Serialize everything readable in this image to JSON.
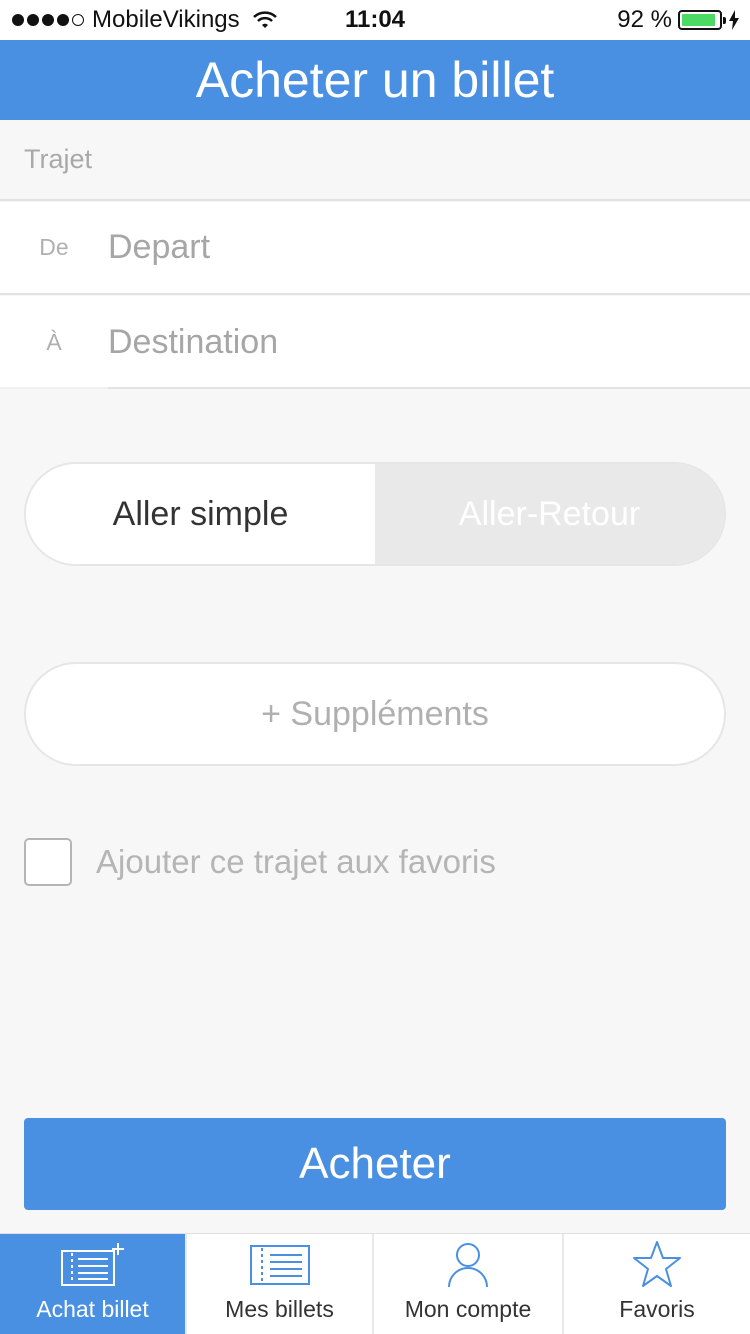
{
  "status_bar": {
    "carrier": "MobileVikings",
    "time": "11:04",
    "battery": "92 %",
    "battery_level": 0.92,
    "icons": [
      "signal-dots-icon",
      "wifi-icon",
      "battery-icon",
      "charging-bolt-icon"
    ]
  },
  "nav": {
    "title": "Acheter un billet"
  },
  "trip": {
    "section_title": "Trajet",
    "from_label": "De",
    "from_placeholder": "Depart",
    "from_value": "",
    "to_label": "À",
    "to_placeholder": "Destination",
    "to_value": ""
  },
  "trip_type": {
    "options": [
      "Aller simple",
      "Aller-Retour"
    ],
    "selected": "Aller simple"
  },
  "supplements_label": "+ Suppléments",
  "favorite": {
    "label": "Ajouter ce trajet aux favoris",
    "checked": false
  },
  "buy_label": "Acheter",
  "tabs": [
    {
      "label": "Achat billet",
      "icon": "ticket-add-icon",
      "active": true
    },
    {
      "label": "Mes billets",
      "icon": "ticket-list-icon",
      "active": false
    },
    {
      "label": "Mon compte",
      "icon": "person-icon",
      "active": false
    },
    {
      "label": "Favoris",
      "icon": "star-icon",
      "active": false
    }
  ],
  "colors": {
    "accent": "#4a90e2",
    "battery": "#4cd964"
  }
}
